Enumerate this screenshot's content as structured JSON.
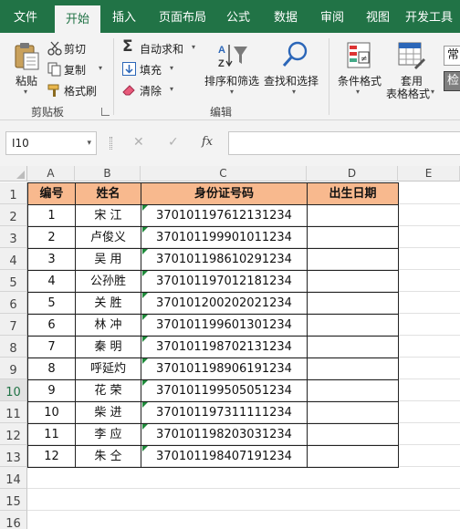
{
  "ribbon_tabs": [
    "文件",
    "开始",
    "插入",
    "页面布局",
    "公式",
    "数据",
    "审阅",
    "视图",
    "开发工具"
  ],
  "active_tab": "开始",
  "clipboard": {
    "paste": "粘贴",
    "cut": "剪切",
    "copy": "复制",
    "format_painter": "格式刷",
    "group_label": "剪贴板"
  },
  "editing": {
    "autosum": "自动求和",
    "fill": "填充",
    "clear": "清除",
    "sort_filter": "排序和筛选",
    "find_select": "查找和选择",
    "group_label": "编辑"
  },
  "styles": {
    "conditional_format": "条件格式",
    "table_format_line1": "套用",
    "table_format_line2": "表格格式",
    "style_box_1": "常",
    "style_box_2": "检"
  },
  "formula_bar": {
    "name_box": "I10",
    "cancel_symbol": "✕",
    "enter_symbol": "✓",
    "fx": "fx",
    "formula": ""
  },
  "columns": [
    "A",
    "B",
    "C",
    "D",
    "E"
  ],
  "row_numbers": [
    "1",
    "2",
    "3",
    "4",
    "5",
    "6",
    "7",
    "8",
    "9",
    "10",
    "11",
    "12",
    "13",
    "14",
    "15",
    "16"
  ],
  "table": {
    "headers": [
      "编号",
      "姓名",
      "身份证号码",
      "出生日期"
    ],
    "rows": [
      [
        "1",
        "宋  江",
        "370101197612131234",
        ""
      ],
      [
        "2",
        "卢俊义",
        "370101199901011234",
        ""
      ],
      [
        "3",
        "吴  用",
        "370101198610291234",
        ""
      ],
      [
        "4",
        "公孙胜",
        "370101197012181234",
        ""
      ],
      [
        "5",
        "关  胜",
        "370101200202021234",
        ""
      ],
      [
        "6",
        "林  冲",
        "370101199601301234",
        ""
      ],
      [
        "7",
        "秦  明",
        "370101198702131234",
        ""
      ],
      [
        "8",
        "呼延灼",
        "370101198906191234",
        ""
      ],
      [
        "9",
        "花  荣",
        "370101199505051234",
        ""
      ],
      [
        "10",
        "柴  进",
        "370101197311111234",
        ""
      ],
      [
        "11",
        "李  应",
        "370101198203031234",
        ""
      ],
      [
        "12",
        "朱  仝",
        "370101198407191234",
        ""
      ]
    ]
  },
  "colors": {
    "ribbon_green": "#217346",
    "header_fill": "#f8b98e",
    "text_indicator": "#1e8a3a"
  },
  "selected_cell": "I10"
}
